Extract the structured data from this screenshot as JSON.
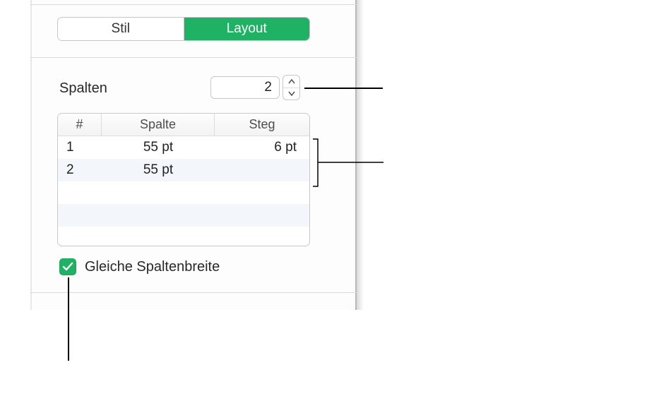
{
  "tabs": {
    "stil": "Stil",
    "layout": "Layout"
  },
  "columns": {
    "label": "Spalten",
    "value": "2",
    "table_headers": {
      "num": "#",
      "spalte": "Spalte",
      "steg": "Steg"
    },
    "rows": [
      {
        "num": "1",
        "spalte": "55 pt",
        "steg": "6 pt"
      },
      {
        "num": "2",
        "spalte": "55 pt",
        "steg": ""
      }
    ],
    "equal_width_label": "Gleiche Spaltenbreite",
    "equal_width_checked": true
  }
}
